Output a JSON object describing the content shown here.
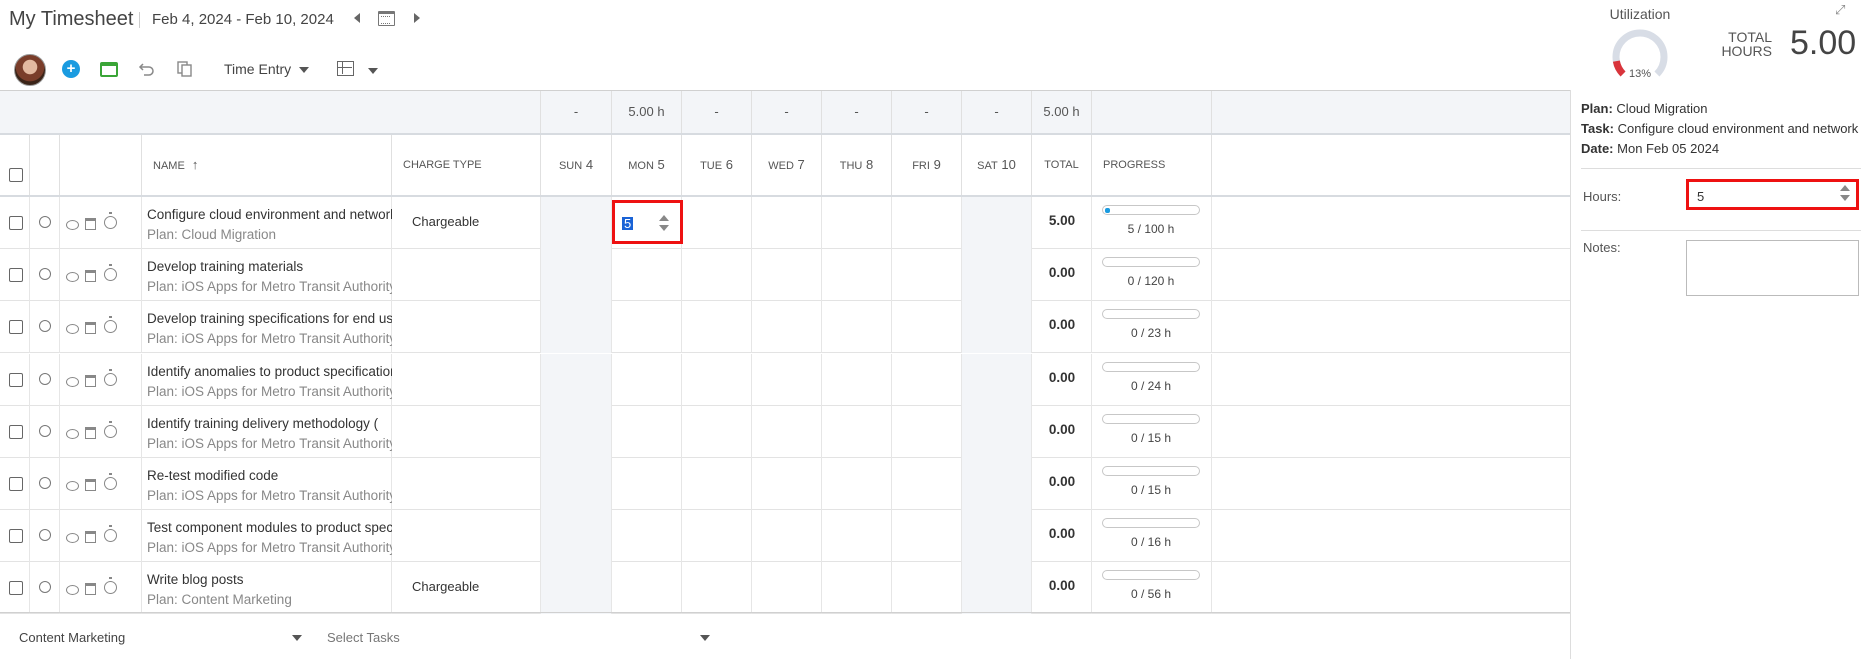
{
  "header": {
    "title": "My Timesheet",
    "date_range": "Feb 4, 2024 - Feb 10, 2024",
    "time_entry_label": "Time Entry"
  },
  "utilization": {
    "label": "Utilization",
    "percent_text": "13%",
    "percent": 13,
    "total_hours_label_1": "TOTAL",
    "total_hours_label_2": "HOURS",
    "total_hours_value": "5.00"
  },
  "summary_row": [
    "-",
    "5.00 h",
    "-",
    "-",
    "-",
    "-",
    "-",
    "5.00 h"
  ],
  "columns": {
    "name": "NAME",
    "sort_icon": "↑",
    "charge_type": "CHARGE TYPE",
    "days": [
      {
        "abbr": "SUN",
        "num": "4"
      },
      {
        "abbr": "MON",
        "num": "5"
      },
      {
        "abbr": "TUE",
        "num": "6"
      },
      {
        "abbr": "WED",
        "num": "7"
      },
      {
        "abbr": "THU",
        "num": "8"
      },
      {
        "abbr": "FRI",
        "num": "9"
      },
      {
        "abbr": "SAT",
        "num": "10"
      }
    ],
    "total": "TOTAL",
    "progress": "PROGRESS"
  },
  "rows": [
    {
      "name": "Configure cloud environment and network",
      "plan": "Plan: Cloud Migration",
      "charge": "Chargeable",
      "mon": "5",
      "total": "5.00",
      "progress": "5 / 100 h",
      "progress_fraction": 0.05
    },
    {
      "name": "Develop training materials",
      "plan": "Plan: iOS Apps for Metro Transit Authority",
      "charge": "",
      "total": "0.00",
      "progress": "0 / 120 h",
      "progress_fraction": 0
    },
    {
      "name": "Develop training specifications for end users",
      "plan": "Plan: iOS Apps for Metro Transit Authority",
      "charge": "",
      "total": "0.00",
      "progress": "0 / 23 h",
      "progress_fraction": 0
    },
    {
      "name": "Identify anomalies to product specifications",
      "plan": "Plan: iOS Apps for Metro Transit Authority",
      "charge": "",
      "total": "0.00",
      "progress": "0 / 24 h",
      "progress_fraction": 0
    },
    {
      "name": "Identify training delivery methodology (",
      "plan": "Plan: iOS Apps for Metro Transit Authority",
      "charge": "",
      "total": "0.00",
      "progress": "0 / 15 h",
      "progress_fraction": 0
    },
    {
      "name": "Re-test modified code",
      "plan": "Plan: iOS Apps for Metro Transit Authority",
      "charge": "",
      "total": "0.00",
      "progress": "0 / 15 h",
      "progress_fraction": 0
    },
    {
      "name": "Test component modules to product specifications",
      "plan": "Plan: iOS Apps for Metro Transit Authority",
      "charge": "",
      "total": "0.00",
      "progress": "0 / 16 h",
      "progress_fraction": 0
    },
    {
      "name": "Write blog posts",
      "plan": "Plan: Content Marketing",
      "charge": "Chargeable",
      "total": "0.00",
      "progress": "0 / 56 h",
      "progress_fraction": 0
    }
  ],
  "footer": {
    "plan_select": "Content Marketing",
    "task_select_placeholder": "Select Tasks"
  },
  "side_panel": {
    "plan_label": "Plan:",
    "plan_value": "Cloud Migration",
    "task_label": "Task:",
    "task_value": "Configure cloud environment and network",
    "date_label": "Date:",
    "date_value": "Mon Feb 05 2024",
    "hours_label": "Hours:",
    "hours_value": "5",
    "notes_label": "Notes:"
  },
  "colors": {
    "accent": "#1a9be0",
    "highlight_border": "#ee1111",
    "weekend_bg": "#f3f5f8"
  }
}
